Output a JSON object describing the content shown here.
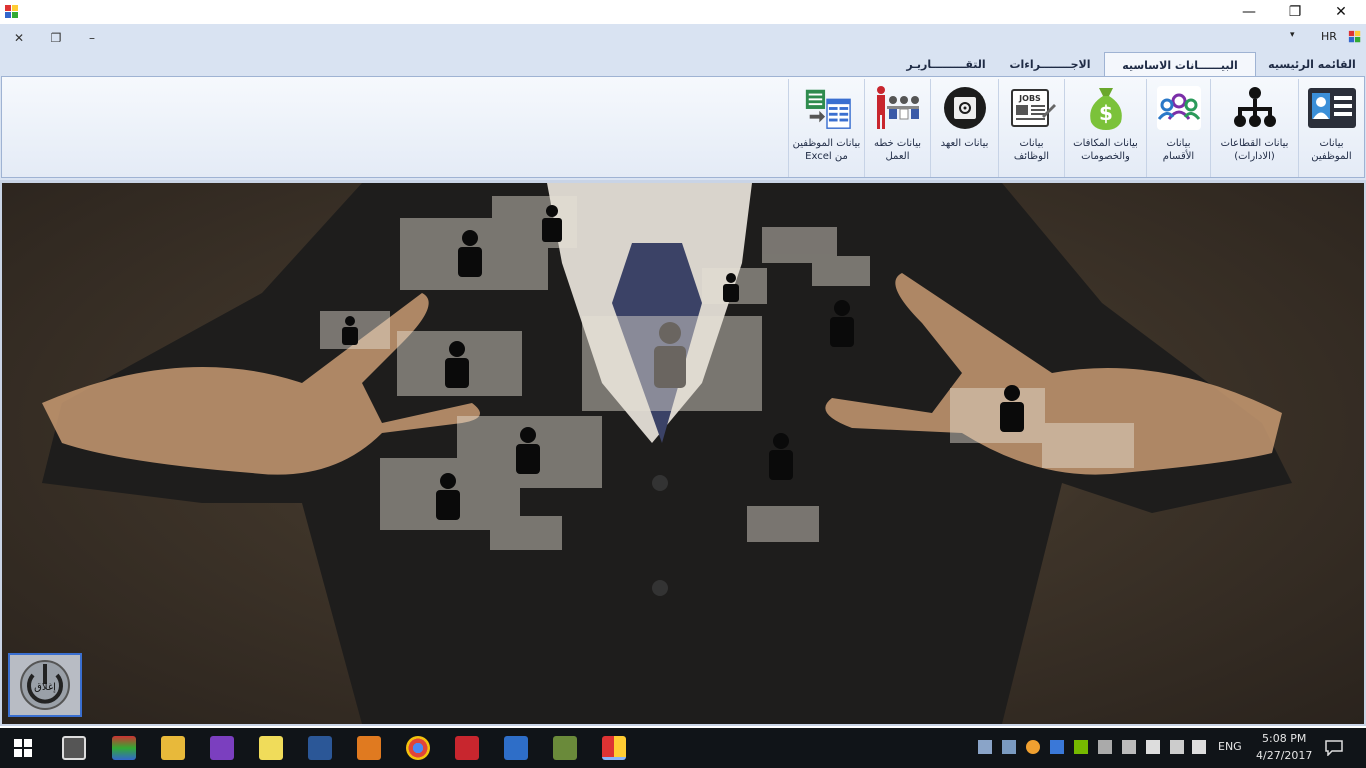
{
  "window": {
    "minimize_glyph": "—",
    "maximize_glyph": "❐",
    "close_glyph": "✕"
  },
  "mdi": {
    "close_glyph": "✕",
    "restore_glyph": "❐",
    "minimize_glyph": "–",
    "dropdown_glyph": "▾",
    "label": "HR"
  },
  "tabs": [
    {
      "label": "القائمه الرئيسيه",
      "active": false
    },
    {
      "label": "البيــــــانات الاساسيه",
      "active": true
    },
    {
      "label": "الاجــــــــراءات",
      "active": false
    },
    {
      "label": "التقـــــــــاريـر",
      "active": false
    }
  ],
  "ribbon": {
    "buttons": [
      {
        "label": "بيانات\nالموظفين",
        "icon": "employee-card-icon"
      },
      {
        "label": "بيانات القطاعات\n(الادارات)",
        "icon": "org-chart-icon"
      },
      {
        "label": "بيانات\nالأقسام",
        "icon": "people-group-icon"
      },
      {
        "label": "بيانات المكافات\nوالخصومات",
        "icon": "money-bag-icon"
      },
      {
        "label": "بيانات\nالوظائف",
        "icon": "jobs-newspaper-icon"
      },
      {
        "label": "بيانات العهد",
        "icon": "safe-icon"
      },
      {
        "label": "بيانات خطه\nالعمل",
        "icon": "team-plan-icon"
      },
      {
        "label": "بيانات الموظفين\nمن  Excel",
        "icon": "excel-import-icon"
      }
    ],
    "jobs_text": "JOBS"
  },
  "exit_button": {
    "label": "إغلاق"
  },
  "taskbar": {
    "lang": "ENG",
    "time": "5:08 PM",
    "date": "4/27/2017"
  },
  "colors": {
    "ribbon_bg": "#d9e3f2",
    "taskbar_bg": "#101418",
    "accent": "#3a6fd0"
  }
}
